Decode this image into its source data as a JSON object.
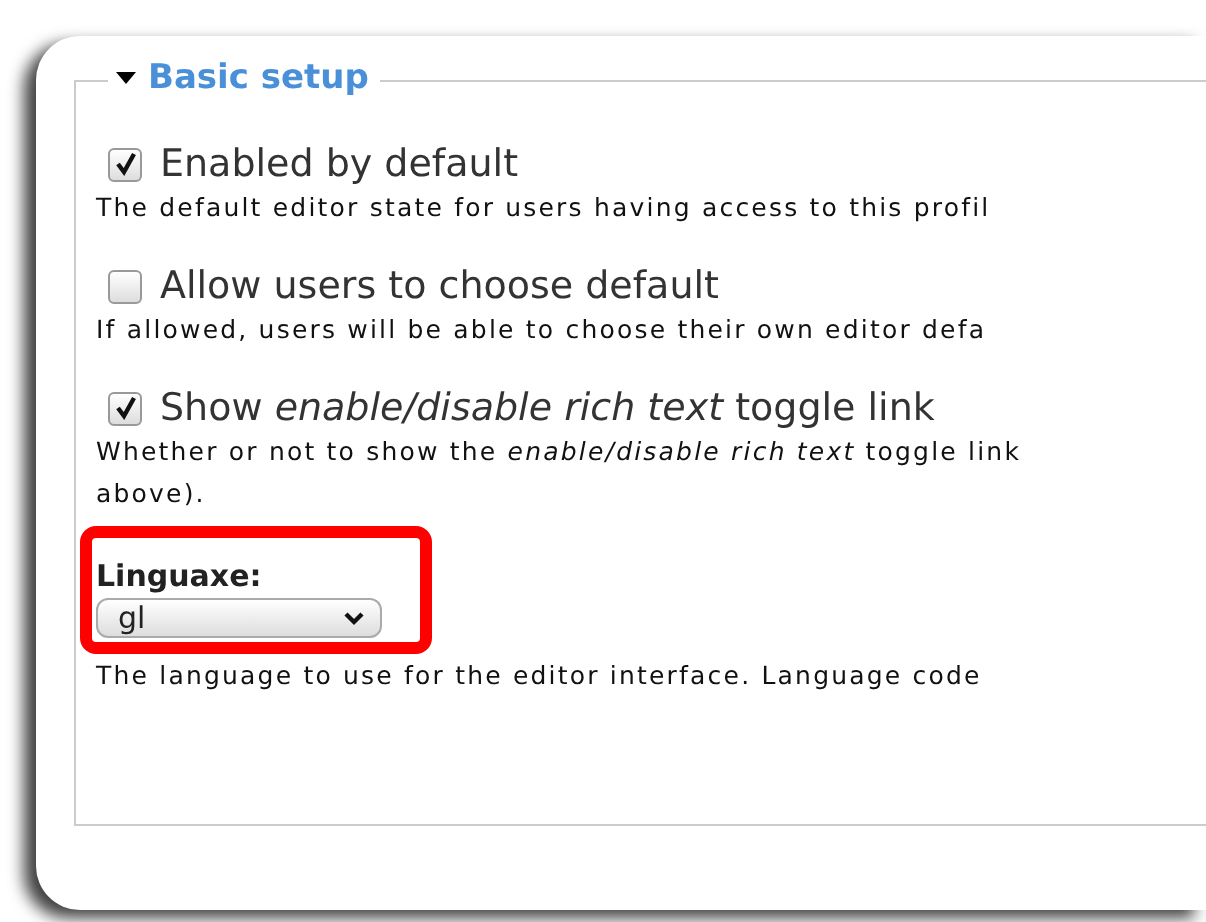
{
  "fieldset": {
    "legend": "Basic setup",
    "expanded": true,
    "items": [
      {
        "kind": "checkbox",
        "label": "Enabled by default",
        "checked": true,
        "description": "The default editor state for users having access to this profil"
      },
      {
        "kind": "checkbox",
        "label": "Allow users to choose default",
        "checked": false,
        "description": "If allowed, users will be able to choose their own editor defa"
      },
      {
        "kind": "checkbox",
        "label": "Show *enable/disable rich text* toggle link",
        "checked": true,
        "description": "Whether or not to show the *enable/disable rich text* toggle link",
        "description_2": "above)."
      },
      {
        "kind": "select",
        "label": "Linguaxe:",
        "value": "gl",
        "highlighted": true,
        "description": "The language to use for the editor interface. Language code"
      }
    ]
  }
}
